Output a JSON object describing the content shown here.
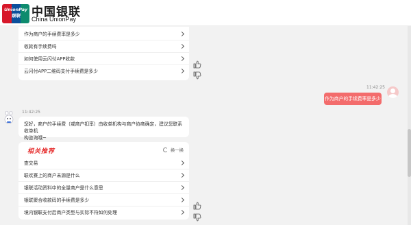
{
  "header": {
    "logo_badge_text_line1": "UnionPay",
    "logo_badge_text_line2": "银联",
    "logo_cn": "中国银联",
    "logo_en": "China UnionPay"
  },
  "top_card": {
    "items": [
      {
        "label": "作为商户的手续费率是多少"
      },
      {
        "label": "收款有手续费吗"
      },
      {
        "label": "如何使用云闪付APP收款"
      },
      {
        "label": "云闪付APP二维码支付手续费是多少"
      }
    ]
  },
  "user_message": {
    "timestamp": "11:42:25",
    "text": "作为商户的手续费率是多少"
  },
  "bot_message": {
    "timestamp": "11:42:25",
    "text_line1": "您好，商户的手续费（或商户扣率）由收单机构与商户协商确定，建议您联系收单机",
    "text_line2": "构咨询哦~"
  },
  "hot_card": {
    "title": "相关推荐",
    "swap_label": "换一换",
    "items": [
      {
        "label": "查交易"
      },
      {
        "label": "联欢赛上的商户未源是什么"
      },
      {
        "label": "银联活动资料中的全量商户是什么意思"
      },
      {
        "label": "银联聚合收款码的手续费是多少"
      },
      {
        "label": "境内银联支付后商户类型与实际不符如何处理"
      }
    ]
  },
  "colors": {
    "accent": "#f36c6c",
    "hot_title": "#e62e2e",
    "background": "#f2f2f2"
  }
}
